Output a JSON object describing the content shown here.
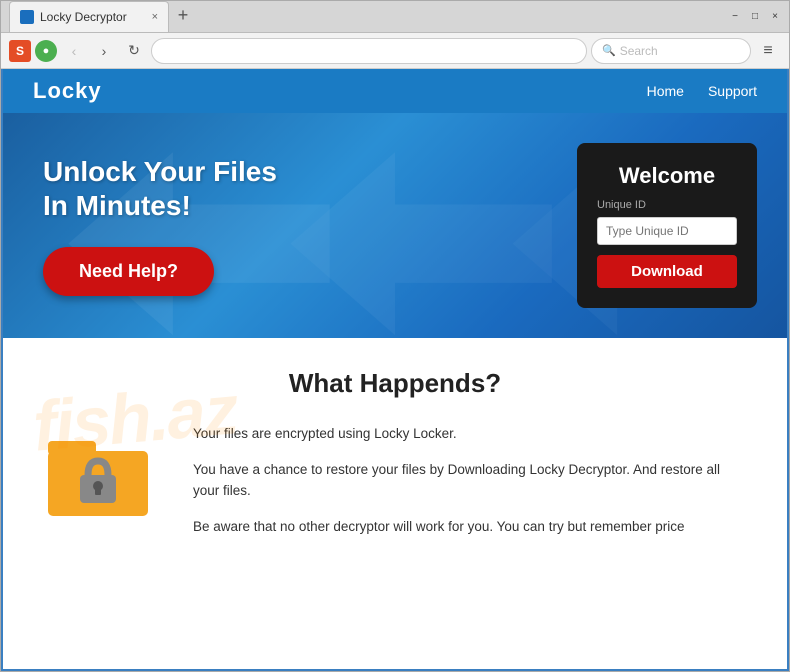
{
  "browser": {
    "tab_title": "Locky Decryptor",
    "tab_close": "×",
    "new_tab": "+",
    "win_minimize": "−",
    "win_restore": "□",
    "win_close": "×",
    "address": "",
    "search_placeholder": "Search",
    "nav_back": "‹",
    "nav_forward": "›",
    "nav_reload": "↻",
    "menu_icon": "≡"
  },
  "site": {
    "logo": "Locky",
    "nav_home": "Home",
    "nav_support": "Support",
    "hero_title_line1": "Unlock Your Files",
    "hero_title_line2": "In Minutes!",
    "need_help_btn": "Need Help?",
    "welcome_card": {
      "title": "Welcome",
      "unique_id_label": "Unique ID",
      "unique_id_placeholder": "Type Unique ID",
      "download_btn": "Download"
    },
    "main": {
      "section_title": "What Happends?",
      "watermark": "fish.az",
      "paragraph1": "Your files are encrypted using Locky Locker.",
      "paragraph2": "You have a chance to restore your files by Downloading Locky Decryptor. And restore all your files.",
      "paragraph3": "Be aware that no other decryptor will work for you. You can try but remember price"
    }
  },
  "colors": {
    "brand_blue": "#1a7bc4",
    "hero_gradient_start": "#1a5fa0",
    "hero_gradient_end": "#2a8fd4",
    "dark_card": "#1a1a1a",
    "red_btn": "#cc1111",
    "folder_orange": "#f5a623"
  }
}
